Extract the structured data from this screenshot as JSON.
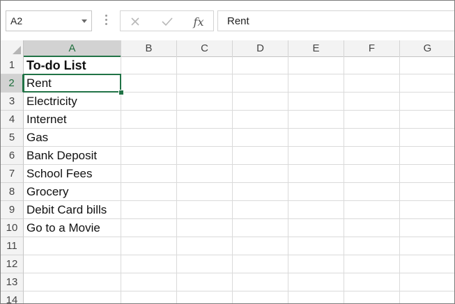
{
  "formula_bar": {
    "name_box": "A2",
    "formula_value": "Rent",
    "icons": {
      "cancel": "close-icon",
      "enter": "check-icon",
      "function": "fx"
    }
  },
  "grid": {
    "columns": [
      "A",
      "B",
      "C",
      "D",
      "E",
      "F",
      "G"
    ],
    "active_column": "A",
    "rows": [
      {
        "num": "1",
        "a": "To-do List",
        "bold": true
      },
      {
        "num": "2",
        "a": "Rent",
        "active": true
      },
      {
        "num": "3",
        "a": "Electricity"
      },
      {
        "num": "4",
        "a": "Internet"
      },
      {
        "num": "5",
        "a": "Gas"
      },
      {
        "num": "6",
        "a": "Bank Deposit"
      },
      {
        "num": "7",
        "a": "School Fees"
      },
      {
        "num": "8",
        "a": "Grocery"
      },
      {
        "num": "9",
        "a": "Debit Card bills"
      },
      {
        "num": "10",
        "a": "Go to a Movie"
      },
      {
        "num": "11",
        "a": ""
      },
      {
        "num": "12",
        "a": ""
      },
      {
        "num": "13",
        "a": ""
      },
      {
        "num": "14",
        "a": ""
      }
    ],
    "selected_cell": "A2"
  },
  "colors": {
    "accent": "#217346",
    "header_bg": "#f3f3f3",
    "active_header_bg": "#d2d2d2"
  }
}
